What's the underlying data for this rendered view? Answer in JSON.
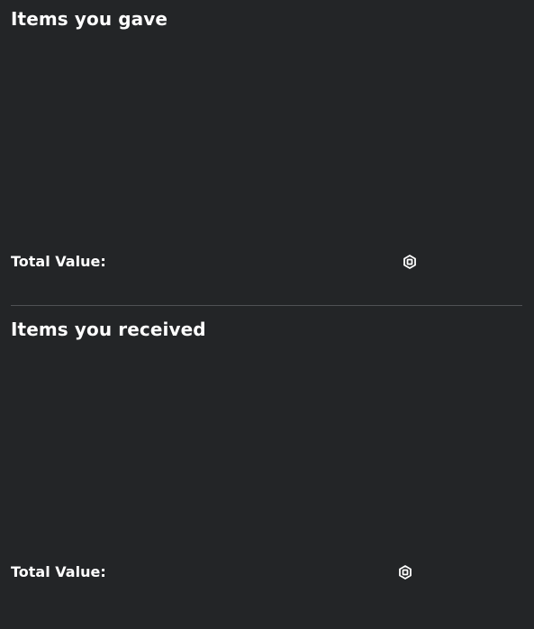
{
  "gave": {
    "title": "Items you gave",
    "total_label": "Total Value:",
    "total_value": "",
    "currency_icon": "robux-icon",
    "items": []
  },
  "received": {
    "title": "Items you received",
    "total_label": "Total Value:",
    "total_value": "",
    "currency_icon": "robux-icon",
    "items": []
  },
  "colors": {
    "background": "#232527",
    "text": "#ffffff",
    "divider": "#4f5154"
  }
}
